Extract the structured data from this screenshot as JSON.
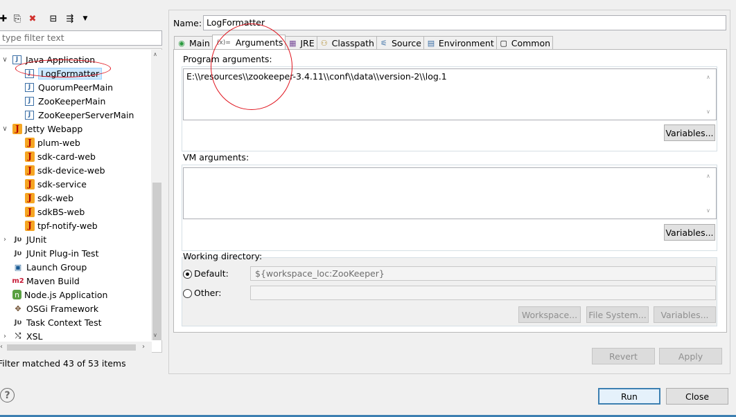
{
  "left": {
    "filter_placeholder": "type filter text",
    "filter_status": "Filter matched 43 of 53 items",
    "tree": [
      {
        "label": "Java Application",
        "level": 0,
        "expanded": true,
        "icon": "java-app-icon",
        "glyph": "J"
      },
      {
        "label": "LogFormatter",
        "level": 1,
        "selected": true,
        "icon": "java-launch-icon",
        "glyph": "J"
      },
      {
        "label": "QuorumPeerMain",
        "level": 1,
        "icon": "java-launch-icon",
        "glyph": "J"
      },
      {
        "label": "ZooKeeperMain",
        "level": 1,
        "icon": "java-launch-icon",
        "glyph": "J"
      },
      {
        "label": "ZooKeeperServerMain",
        "level": 1,
        "icon": "java-launch-icon",
        "glyph": "J"
      },
      {
        "label": "Jetty Webapp",
        "level": 0,
        "expanded": true,
        "icon": "jetty-icon",
        "glyph": "J"
      },
      {
        "label": "plum-web",
        "level": 1,
        "icon": "jetty-icon",
        "glyph": "J"
      },
      {
        "label": "sdk-card-web",
        "level": 1,
        "icon": "jetty-icon",
        "glyph": "J"
      },
      {
        "label": "sdk-device-web",
        "level": 1,
        "icon": "jetty-icon",
        "glyph": "J"
      },
      {
        "label": "sdk-service",
        "level": 1,
        "icon": "jetty-icon",
        "glyph": "J"
      },
      {
        "label": "sdk-web",
        "level": 1,
        "icon": "jetty-icon",
        "glyph": "J"
      },
      {
        "label": "sdkBS-web",
        "level": 1,
        "icon": "jetty-icon",
        "glyph": "J"
      },
      {
        "label": "tpf-notify-web",
        "level": 1,
        "icon": "jetty-icon",
        "glyph": "J"
      },
      {
        "label": "JUnit",
        "level": 0,
        "expanded": false,
        "icon": "junit-icon",
        "glyph": "Jυ"
      },
      {
        "label": "JUnit Plug-in Test",
        "level": 0,
        "icon": "junit-plugin-icon",
        "glyph": "Jυ"
      },
      {
        "label": "Launch Group",
        "level": 0,
        "icon": "launch-group-icon",
        "glyph": "▣"
      },
      {
        "label": "Maven Build",
        "level": 0,
        "icon": "maven-icon",
        "glyph": "m2"
      },
      {
        "label": "Node.js Application",
        "level": 0,
        "icon": "nodejs-icon",
        "glyph": "n"
      },
      {
        "label": "OSGi Framework",
        "level": 0,
        "icon": "osgi-icon",
        "glyph": "✥"
      },
      {
        "label": "Task Context Test",
        "level": 0,
        "icon": "task-context-icon",
        "glyph": "Jυ"
      },
      {
        "label": "XSL",
        "level": 0,
        "expanded": false,
        "icon": "xsl-icon",
        "glyph": "⤭"
      }
    ]
  },
  "right": {
    "name_label": "Name:",
    "name_value": "LogFormatter",
    "tabs": [
      {
        "label": "Main",
        "icon": "main-tab-icon",
        "glyph": "◉"
      },
      {
        "label": "Arguments",
        "icon": "arguments-tab-icon",
        "glyph": "(x)=",
        "active": true
      },
      {
        "label": "JRE",
        "icon": "jre-tab-icon",
        "glyph": "▦"
      },
      {
        "label": "Classpath",
        "icon": "classpath-tab-icon",
        "glyph": "⚇"
      },
      {
        "label": "Source",
        "icon": "source-tab-icon",
        "glyph": "⚟"
      },
      {
        "label": "Environment",
        "icon": "environment-tab-icon",
        "glyph": "▤"
      },
      {
        "label": "Common",
        "icon": "common-tab-icon",
        "glyph": "▢"
      }
    ],
    "program_args_label": "Program arguments:",
    "program_args_value": "E:\\\\resources\\\\zookeeper-3.4.11\\\\conf\\\\data\\\\version-2\\\\log.1",
    "variables_label": "Variables...",
    "vm_args_label": "VM arguments:",
    "vm_args_value": "",
    "working_dir_label": "Working directory:",
    "default_label": "Default:",
    "default_value": "${workspace_loc:ZooKeeper}",
    "other_label": "Other:",
    "other_value": "",
    "workspace_label": "Workspace...",
    "filesystem_label": "File System...",
    "revert_label": "Revert",
    "apply_label": "Apply"
  },
  "footer": {
    "help_glyph": "?",
    "run_label": "Run",
    "close_label": "Close"
  },
  "colors": {
    "annotation": "#e0141e",
    "selection": "#cde8ff",
    "default_button_border": "#3c7fb1"
  }
}
